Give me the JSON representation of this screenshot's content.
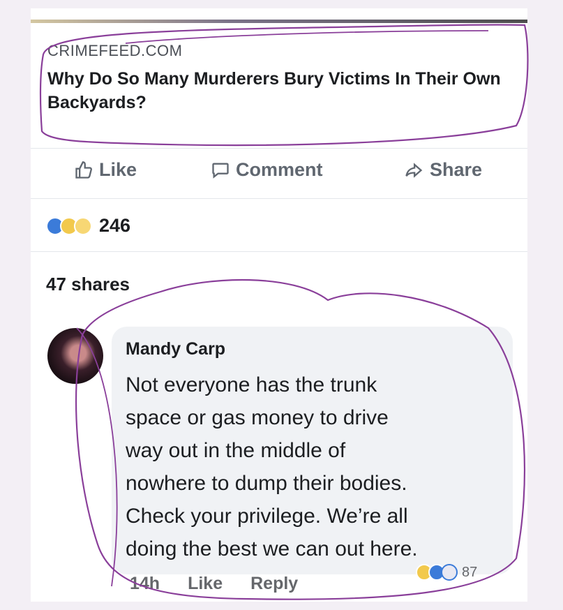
{
  "post": {
    "source": "CRIMEFEED.COM",
    "headline": "Why Do So Many Murderers Bury Victims In Their Own Backyards?"
  },
  "actions": {
    "like": "Like",
    "comment": "Comment",
    "share": "Share"
  },
  "reactions": {
    "icons": [
      "like-icon",
      "wow-icon",
      "haha-icon"
    ],
    "count": "246"
  },
  "shares_text": "47 shares",
  "comment": {
    "author": "Mandy Carp",
    "text": "Not everyone has the trunk\nspace or gas money to drive\nway out in the middle of\nnowhere to dump their bodies.\nCheck your privilege. We’re all\ndoing the best we can out here.",
    "time": "14h",
    "like": "Like",
    "reply": "Reply",
    "reaction_count": "87",
    "reaction_icons": [
      "haha-icon",
      "like-icon",
      "love-icon"
    ]
  },
  "colors": {
    "annotation": "#8a3f9a",
    "like_blue": "#3b7bd9"
  }
}
